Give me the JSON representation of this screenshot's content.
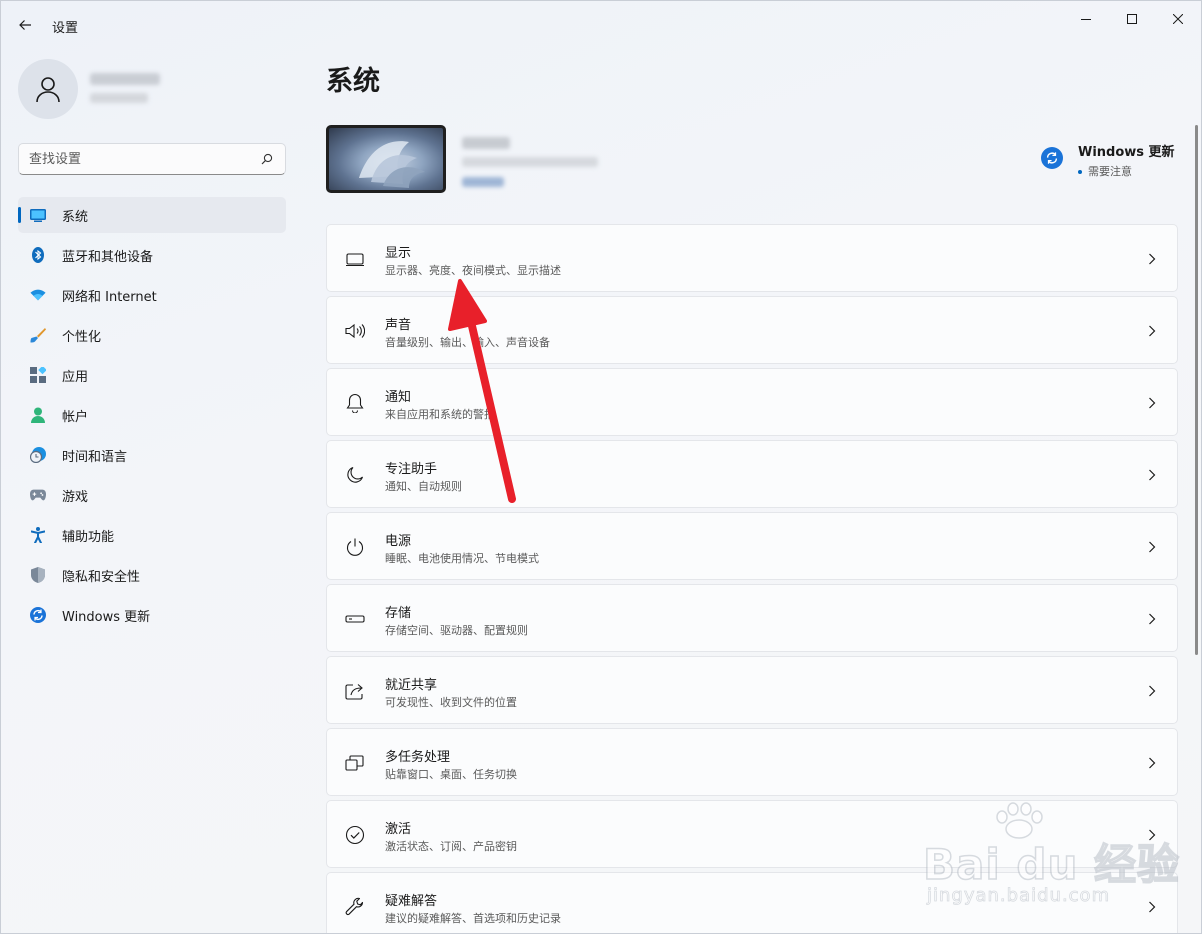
{
  "window": {
    "title": "设置"
  },
  "profile": {
    "name": "",
    "account_type": ""
  },
  "search": {
    "placeholder": "查找设置"
  },
  "sidebar": {
    "items": [
      {
        "label": "系统",
        "icon": "monitor-icon",
        "active": true
      },
      {
        "label": "蓝牙和其他设备",
        "icon": "bluetooth-icon"
      },
      {
        "label": "网络和 Internet",
        "icon": "wifi-icon"
      },
      {
        "label": "个性化",
        "icon": "brush-icon"
      },
      {
        "label": "应用",
        "icon": "apps-icon"
      },
      {
        "label": "帐户",
        "icon": "account-icon"
      },
      {
        "label": "时间和语言",
        "icon": "clock-globe-icon"
      },
      {
        "label": "游戏",
        "icon": "gamepad-icon"
      },
      {
        "label": "辅助功能",
        "icon": "accessibility-icon"
      },
      {
        "label": "隐私和安全性",
        "icon": "shield-icon"
      },
      {
        "label": "Windows 更新",
        "icon": "windows-update-icon"
      }
    ]
  },
  "main": {
    "title": "系统",
    "update": {
      "title": "Windows 更新",
      "status": "需要注意"
    },
    "cards": [
      {
        "title": "显示",
        "desc": "显示器、亮度、夜间模式、显示描述",
        "icon": "display-icon"
      },
      {
        "title": "声音",
        "desc": "音量级别、输出、输入、声音设备",
        "icon": "speaker-icon"
      },
      {
        "title": "通知",
        "desc": "来自应用和系统的警报",
        "icon": "bell-icon"
      },
      {
        "title": "专注助手",
        "desc": "通知、自动规则",
        "icon": "moon-icon"
      },
      {
        "title": "电源",
        "desc": "睡眠、电池使用情况、节电模式",
        "icon": "power-icon"
      },
      {
        "title": "存储",
        "desc": "存储空间、驱动器、配置规则",
        "icon": "storage-icon"
      },
      {
        "title": "就近共享",
        "desc": "可发现性、收到文件的位置",
        "icon": "share-icon"
      },
      {
        "title": "多任务处理",
        "desc": "贴靠窗口、桌面、任务切换",
        "icon": "multitask-icon"
      },
      {
        "title": "激活",
        "desc": "激活状态、订阅、产品密钥",
        "icon": "check-circle-icon"
      },
      {
        "title": "疑难解答",
        "desc": "建议的疑难解答、首选项和历史记录",
        "icon": "wrench-icon"
      }
    ]
  },
  "watermark": {
    "brand": "Bai du 经验",
    "url": "jingyan.baidu.com"
  },
  "colors": {
    "accent": "#0067c0",
    "annotation_arrow": "#e8202a"
  }
}
